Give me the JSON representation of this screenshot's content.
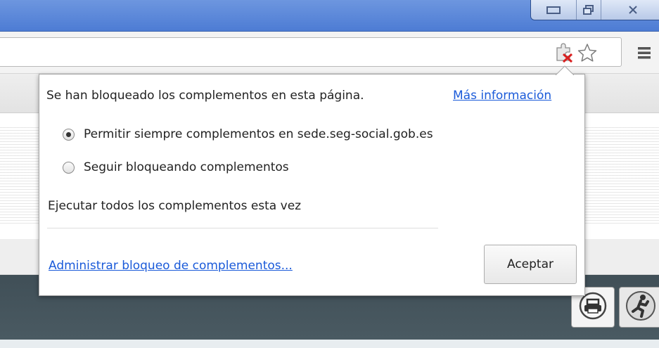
{
  "bubble": {
    "message": "Se han bloqueado los complementos en esta página.",
    "more_info_link": "Más información",
    "options": [
      {
        "label": "Permitir siempre complementos en sede.seg-social.gob.es",
        "selected": true
      },
      {
        "label": "Seguir bloqueando complementos",
        "selected": false
      }
    ],
    "run_all_link": "Ejecutar todos los complementos esta vez",
    "manage_link": "Administrar bloqueo de complementos...",
    "accept_button": "Aceptar"
  },
  "toolbar": {
    "icons": [
      "plugin-blocked-icon",
      "bookmark-star-icon",
      "menu-icon"
    ]
  },
  "window": {
    "buttons": [
      "minimize-icon",
      "restore-icon",
      "close-icon"
    ]
  },
  "page": {
    "action_icons": [
      "print-icon",
      "exit-icon"
    ]
  },
  "colors": {
    "link": "#1a5ad9",
    "titlebar": "#5a87d9",
    "dark_bar": "#44535b"
  }
}
